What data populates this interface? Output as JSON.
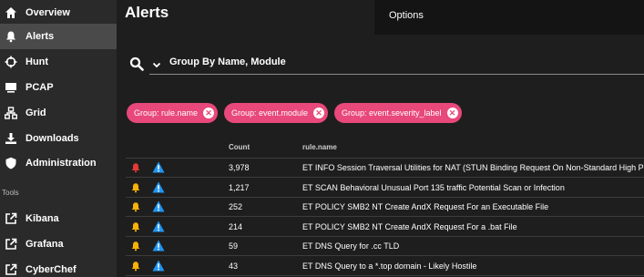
{
  "sidebar": {
    "items": [
      {
        "label": "Overview",
        "icon": "home-icon"
      },
      {
        "label": "Alerts",
        "icon": "bell-icon",
        "active": true
      },
      {
        "label": "Hunt",
        "icon": "crosshairs-icon"
      },
      {
        "label": "PCAP",
        "icon": "pcap-icon"
      },
      {
        "label": "Grid",
        "icon": "grid-icon"
      },
      {
        "label": "Downloads",
        "icon": "download-icon"
      },
      {
        "label": "Administration",
        "icon": "shield-icon"
      }
    ],
    "tools_label": "Tools",
    "tools": [
      {
        "label": "Kibana",
        "icon": "external-link-icon"
      },
      {
        "label": "Grafana",
        "icon": "external-link-icon"
      },
      {
        "label": "CyberChef",
        "icon": "external-link-icon"
      }
    ]
  },
  "main": {
    "title": "Alerts",
    "options_label": "Options",
    "group_by": "Group By Name, Module",
    "chips": [
      {
        "label": "Group: rule.name"
      },
      {
        "label": "Group: event.module"
      },
      {
        "label": "Group: event.severity_label"
      }
    ],
    "table": {
      "headers": {
        "count": "Count",
        "rule": "rule.name"
      },
      "rows": [
        {
          "bell_color": "#e53935",
          "count": "3,978",
          "rule": "ET INFO Session Traversal Utilities for NAT (STUN Binding Request On Non-Standard High Port)"
        },
        {
          "bell_color": "#f9b208",
          "count": "1,217",
          "rule": "ET SCAN Behavioral Unusual Port 135 traffic Potential Scan or Infection"
        },
        {
          "bell_color": "#f9b208",
          "count": "252",
          "rule": "ET POLICY SMB2 NT Create AndX Request For an Executable File"
        },
        {
          "bell_color": "#f9b208",
          "count": "214",
          "rule": "ET POLICY SMB2 NT Create AndX Request For a .bat File"
        },
        {
          "bell_color": "#f9b208",
          "count": "59",
          "rule": "ET DNS Query for .cc TLD"
        },
        {
          "bell_color": "#f9b208",
          "count": "43",
          "rule": "ET DNS Query to a *.top domain - Likely Hostile"
        }
      ]
    }
  },
  "colors": {
    "chip": "#e8487a",
    "warn_triangle": "#2196f3",
    "bell_high": "#e53935",
    "bell_medium": "#f9b208"
  }
}
